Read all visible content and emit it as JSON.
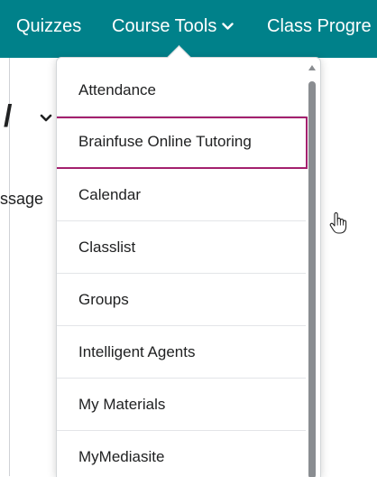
{
  "navbar": {
    "items": [
      {
        "label": "Quizzes"
      },
      {
        "label": "Course Tools"
      },
      {
        "label": "Class Progre"
      }
    ]
  },
  "background": {
    "title_fragment": "/",
    "message_fragment": "ssage"
  },
  "menu": {
    "items": [
      {
        "label": "Attendance"
      },
      {
        "label": "Brainfuse Online Tutoring"
      },
      {
        "label": "Calendar"
      },
      {
        "label": "Classlist"
      },
      {
        "label": "Groups"
      },
      {
        "label": "Intelligent Agents"
      },
      {
        "label": "My Materials"
      },
      {
        "label": "MyMediasite"
      }
    ],
    "focused_item": "Brainfuse Online Tutoring"
  },
  "colors": {
    "navbar": "#00818a",
    "focus_outline": "#a4206e",
    "scroll_thumb": "#8a8d91"
  },
  "icons": {
    "nav_dropdown": "chevron-down-icon",
    "cursor": "hand-pointer-icon",
    "scroll": "scroll-up-arrow-icon"
  }
}
